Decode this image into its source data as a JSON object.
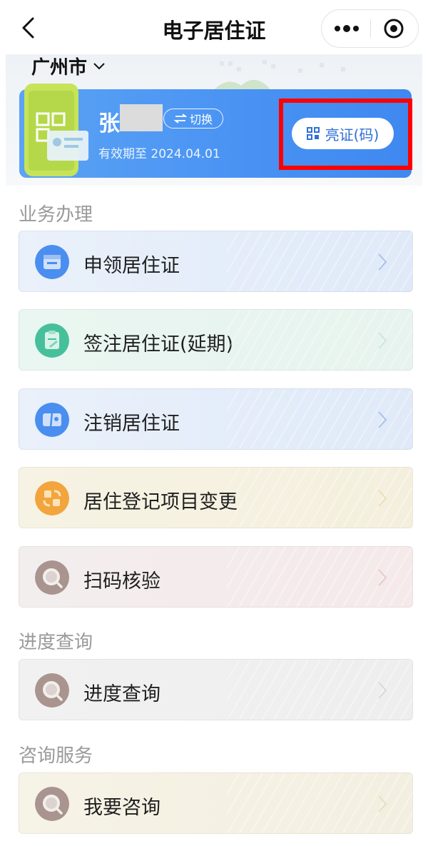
{
  "nav": {
    "title": "电子居住证",
    "back_icon": "chevron-left-icon",
    "more_icon": "more-dots-icon",
    "close_icon": "target-circle-icon"
  },
  "city": {
    "name": "广州市",
    "dropdown_icon": "chevron-down-icon"
  },
  "card": {
    "name_visible": "张",
    "switch_label": "切换",
    "switch_icon": "swap-arrows-icon",
    "validity": "有效期至 2024.04.01",
    "show_code_label": "亮证(码)",
    "show_code_icon": "qr-code-icon"
  },
  "sections": {
    "business": "业务办理",
    "progress": "进度查询",
    "consult": "咨询服务"
  },
  "items": [
    {
      "label": "申领居住证",
      "icon": "id-card-icon",
      "accent": "#4a8ef0"
    },
    {
      "label": "签注居住证(延期)",
      "icon": "clipboard-edit-icon",
      "accent": "#46c09b"
    },
    {
      "label": "注销居住证",
      "icon": "cancel-card-icon",
      "accent": "#4a8ef0"
    },
    {
      "label": "居住登记项目变更",
      "icon": "exchange-icon",
      "accent": "#f2a53c"
    },
    {
      "label": "扫码核验",
      "icon": "search-icon",
      "accent": "#a9948f"
    },
    {
      "label": "进度查询",
      "icon": "search-icon",
      "accent": "#a9948f"
    },
    {
      "label": "我要咨询",
      "icon": "search-icon",
      "accent": "#a9948f"
    }
  ],
  "colors": {
    "card_blue": "#4a93f3",
    "highlight_red": "#ff0000",
    "section_grey": "#9a9a9a"
  }
}
